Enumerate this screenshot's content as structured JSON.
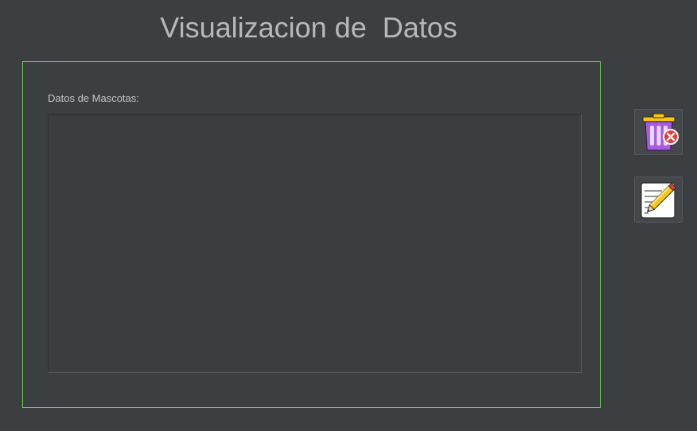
{
  "window": {
    "title": "Visualizacion de  Datos"
  },
  "panel": {
    "label": "Datos de Mascotas:",
    "content": "",
    "border_color": "#6ad34a"
  },
  "actions": {
    "delete_icon": "trash-delete-icon",
    "edit_icon": "edit-notepad-pencil-icon"
  },
  "colors": {
    "background": "#3c3f41",
    "title_text": "#b8b8b8",
    "trash_body": "#a55ce0",
    "trash_lid": "#f5c518",
    "delete_badge": "#e23b3b",
    "pencil": "#f5c518"
  }
}
